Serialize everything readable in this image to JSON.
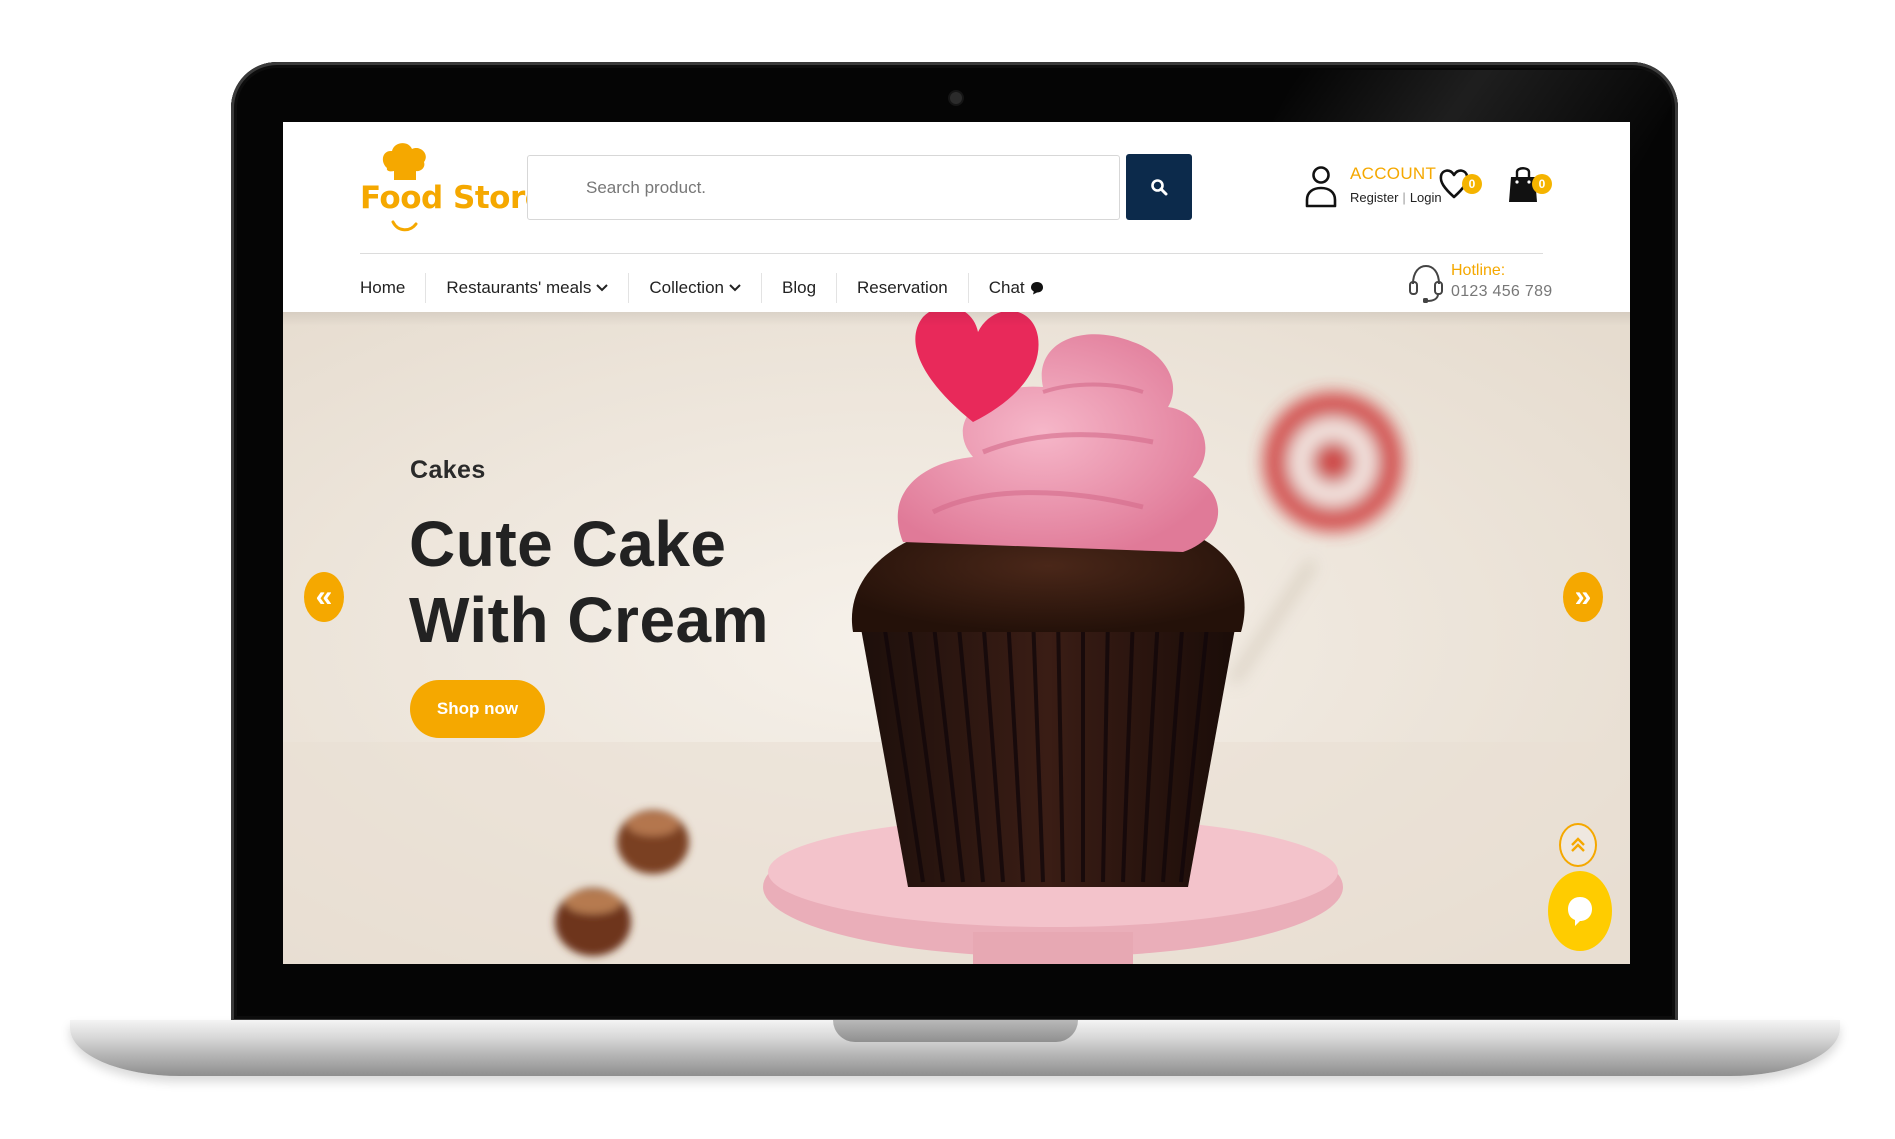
{
  "brand": {
    "logo_text": "Food Store",
    "accent_color": "#f5a800",
    "navy_color": "#0c2a4b"
  },
  "search": {
    "placeholder": "Search product.",
    "button_icon": "search-icon"
  },
  "account": {
    "label": "ACCOUNT",
    "register": "Register",
    "login": "Login",
    "separator": "|",
    "wishlist_count": "0",
    "cart_count": "0"
  },
  "nav": {
    "items": [
      {
        "label": "Home"
      },
      {
        "label": "Restaurants' meals"
      },
      {
        "label": "Collection"
      },
      {
        "label": "Blog"
      },
      {
        "label": "Reservation"
      },
      {
        "label": "Chat"
      }
    ]
  },
  "hotline": {
    "label": "Hotline:",
    "number": "0123 456 789"
  },
  "hero": {
    "subtitle": "Cakes",
    "title_line1": "Cute Cake",
    "title_line2": "With Cream",
    "cta": "Shop now",
    "prev_arrow": "«",
    "next_arrow": "»"
  }
}
